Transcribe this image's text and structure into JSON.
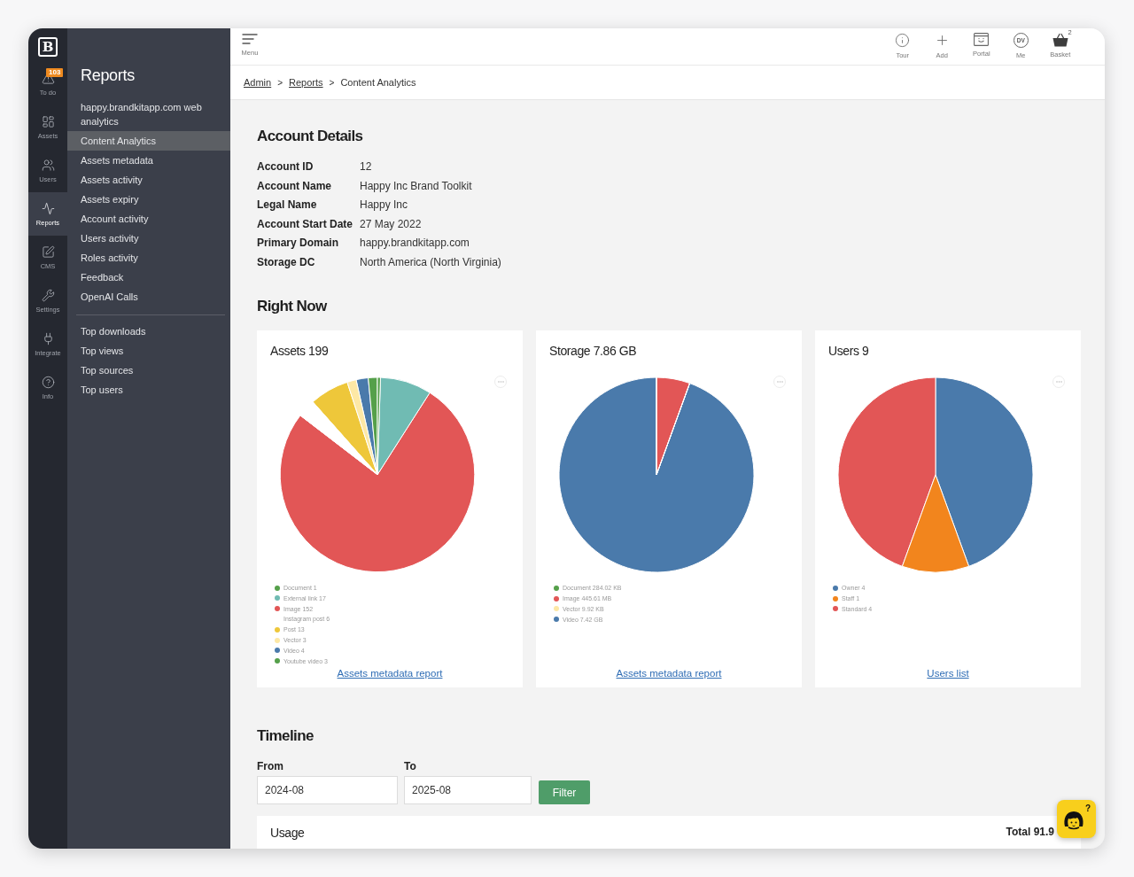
{
  "logo": {
    "text": "B"
  },
  "rail": [
    {
      "kind": "todo",
      "label": "To do",
      "badge": "103",
      "selected": false
    },
    {
      "kind": "assets",
      "label": "Assets",
      "selected": false
    },
    {
      "kind": "users",
      "label": "Users",
      "selected": false
    },
    {
      "kind": "reports",
      "label": "Reports",
      "selected": true
    },
    {
      "kind": "cms",
      "label": "CMS",
      "selected": false
    },
    {
      "kind": "settings",
      "label": "Settings",
      "selected": false
    },
    {
      "kind": "integrate",
      "label": "Integrate",
      "selected": false
    },
    {
      "kind": "info",
      "label": "Info",
      "selected": false
    }
  ],
  "sidebar": {
    "title": "Reports",
    "groups": [
      [
        {
          "label": "happy.brandkitapp.com web analytics",
          "selected": false
        },
        {
          "label": "Content Analytics",
          "selected": true
        },
        {
          "label": "Assets metadata",
          "selected": false
        },
        {
          "label": "Assets activity",
          "selected": false
        },
        {
          "label": "Assets expiry",
          "selected": false
        },
        {
          "label": "Account activity",
          "selected": false
        },
        {
          "label": "Users activity",
          "selected": false
        },
        {
          "label": "Roles activity",
          "selected": false
        },
        {
          "label": "Feedback",
          "selected": false
        },
        {
          "label": "OpenAI Calls",
          "selected": false
        }
      ],
      [
        {
          "label": "Top downloads",
          "selected": false
        },
        {
          "label": "Top views",
          "selected": false
        },
        {
          "label": "Top sources",
          "selected": false
        },
        {
          "label": "Top users",
          "selected": false
        }
      ]
    ]
  },
  "topbar": {
    "menu": {
      "label": "Menu"
    },
    "actions": [
      {
        "kind": "tour",
        "label": "Tour"
      },
      {
        "kind": "add",
        "label": "Add"
      },
      {
        "kind": "portal",
        "label": "Portal"
      },
      {
        "kind": "me",
        "label": "Me",
        "initials": "DV"
      },
      {
        "kind": "basket",
        "label": "Basket",
        "count": "2"
      }
    ]
  },
  "breadcrumb": {
    "items": [
      {
        "label": "Admin",
        "link": true,
        "separator": ">"
      },
      {
        "label": "Reports",
        "link": true,
        "separator": ">"
      },
      {
        "label": "Content Analytics",
        "link": false
      }
    ]
  },
  "account_details": {
    "title": "Account Details",
    "rows": [
      {
        "label": "Account ID",
        "value": "12"
      },
      {
        "label": "Account Name",
        "value": "Happy Inc Brand Toolkit"
      },
      {
        "label": "Legal Name",
        "value": "Happy Inc"
      },
      {
        "label": "Account Start Date",
        "value": "27 May 2022"
      },
      {
        "label": "Primary Domain",
        "value": "happy.brandkitapp.com"
      },
      {
        "label": "Storage DC",
        "value": "North America (North Virginia)"
      }
    ]
  },
  "right_now": {
    "title": "Right Now",
    "cards": [
      {
        "title": "Assets 199",
        "chart_data": {
          "type": "pie",
          "categories": [
            "Document 1",
            "External link 17",
            "Image 152",
            "Instagram post 6",
            "Post 13",
            "Vector 3",
            "Video 4",
            "Youtube video 3"
          ],
          "values": [
            0.5025,
            8.5427,
            76.3819,
            3.0151,
            6.5327,
            1.5075,
            2.0101,
            1.5075
          ]
        },
        "legend": [
          {
            "color": "#55a04a"
          },
          {
            "color": "#70bbb3"
          },
          {
            "color": "#e25656"
          },
          {
            "marker": false
          },
          {
            "color": "#eec73a"
          },
          {
            "color": "#fde8a5"
          },
          {
            "color": "#4a7aab"
          },
          {
            "color": "#55a04a"
          }
        ],
        "link": "Assets metadata report"
      },
      {
        "title": "Storage 7.86 GB",
        "chart_data": {
          "type": "pie",
          "categories": [
            "Document 284.02 KB",
            "Image 445.61 MB",
            "Vector 9.92 KB",
            "Video 7.42 GB"
          ],
          "values": [
            0.0034,
            5.5397,
            0.0001,
            94.4568
          ]
        },
        "legend": [
          {
            "color": "#55a04a"
          },
          {
            "color": "#e25656"
          },
          {
            "color": "#fde8a5"
          },
          {
            "color": "#4a7aab"
          }
        ],
        "link": "Assets metadata report"
      },
      {
        "title": "Users 9",
        "chart_data": {
          "type": "pie",
          "categories": [
            "Owner 4",
            "Staff 1",
            "Standard 4"
          ],
          "values": [
            44.4444,
            11.1112,
            44.4444
          ]
        },
        "legend": [
          {
            "color": "#4a7aab"
          },
          {
            "color": "#f2851d"
          },
          {
            "color": "#e25656"
          }
        ],
        "link": "Users list"
      }
    ]
  },
  "timeline": {
    "title": "Timeline",
    "from": {
      "label": "From",
      "value": "2024-08"
    },
    "to": {
      "label": "To",
      "value": "2025-08"
    },
    "button": "Filter"
  },
  "usage": {
    "title": "Usage",
    "total": "Total 91.9"
  },
  "help_widget": {
    "mark": "?"
  }
}
